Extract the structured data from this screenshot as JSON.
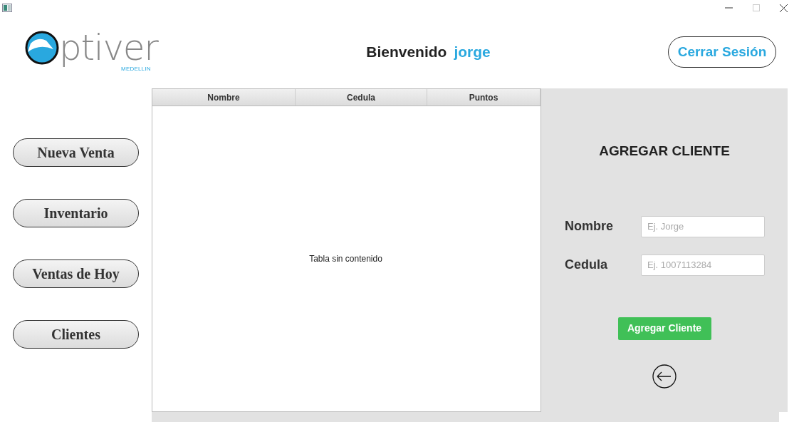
{
  "logo": {
    "wordmark": "ptiver",
    "city": "MEDELLIN"
  },
  "header": {
    "greeting": "Bienvenido",
    "user": "jorge",
    "logout": "Cerrar Sesión"
  },
  "sidebar": {
    "items": [
      "Nueva Venta",
      "Inventario",
      "Ventas de Hoy",
      "Clientes"
    ]
  },
  "table": {
    "columns": [
      "Nombre",
      "Cedula",
      "Puntos"
    ],
    "empty_message": "Tabla sin contenido"
  },
  "form": {
    "title": "AGREGAR CLIENTE",
    "fields": [
      {
        "label": "Nombre",
        "placeholder": "Ej. Jorge"
      },
      {
        "label": "Cedula",
        "placeholder": "Ej. 1007113284"
      }
    ],
    "submit": "Agregar Cliente"
  }
}
